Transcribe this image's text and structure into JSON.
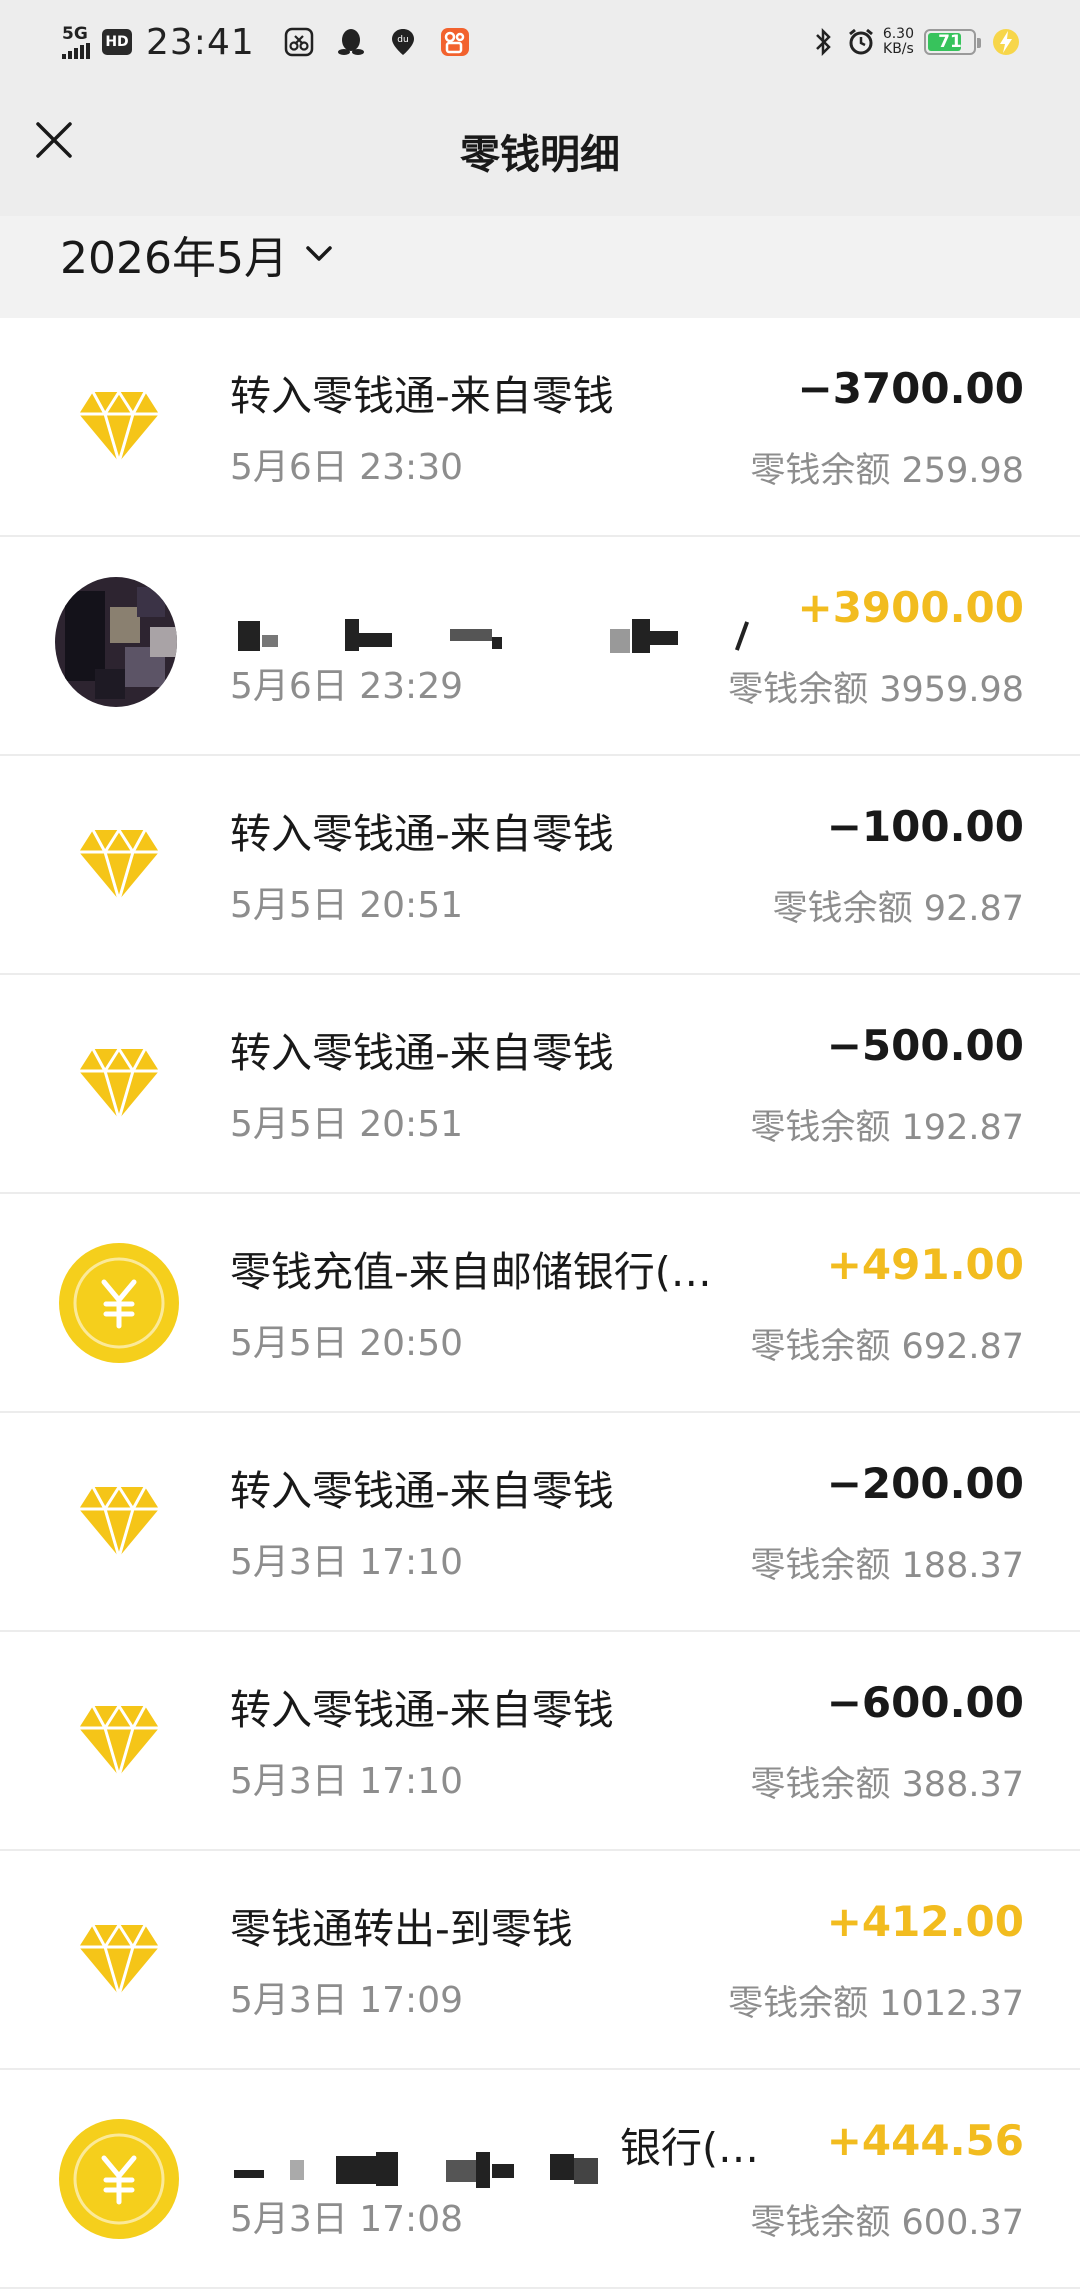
{
  "status_bar": {
    "network": "5G",
    "hd": "HD",
    "time": "23:41",
    "speed_value": "6.30",
    "speed_unit": "KB/s",
    "battery": "71"
  },
  "header": {
    "title": "零钱明细"
  },
  "filter": {
    "month": "2026年5月"
  },
  "transactions": [
    {
      "title": "转入零钱通-来自零钱",
      "date": "5月6日 23:30",
      "amount": "−3700.00",
      "balance": "零钱余额 259.98",
      "icon": "diamond-icon"
    },
    {
      "title": "",
      "date": "5月6日 23:29",
      "amount": "+3900.00",
      "balance": "零钱余额 3959.98",
      "icon": "avatar"
    },
    {
      "title": "转入零钱通-来自零钱",
      "date": "5月5日 20:51",
      "amount": "−100.00",
      "balance": "零钱余额 92.87",
      "icon": "diamond-icon"
    },
    {
      "title": "转入零钱通-来自零钱",
      "date": "5月5日 20:51",
      "amount": "−500.00",
      "balance": "零钱余额 192.87",
      "icon": "diamond-icon"
    },
    {
      "title": "零钱充值-来自邮储银行(…",
      "date": "5月5日 20:50",
      "amount": "+491.00",
      "balance": "零钱余额 692.87",
      "icon": "yuan-coin-icon"
    },
    {
      "title": "转入零钱通-来自零钱",
      "date": "5月3日 17:10",
      "amount": "−200.00",
      "balance": "零钱余额 188.37",
      "icon": "diamond-icon"
    },
    {
      "title": "转入零钱通-来自零钱",
      "date": "5月3日 17:10",
      "amount": "−600.00",
      "balance": "零钱余额 388.37",
      "icon": "diamond-icon"
    },
    {
      "title": "零钱通转出-到零钱",
      "date": "5月3日 17:09",
      "amount": "+412.00",
      "balance": "零钱余额 1012.37",
      "icon": "diamond-icon"
    },
    {
      "title": "银行(…",
      "date": "5月3日 17:08",
      "amount": "+444.56",
      "balance": "零钱余额 600.37",
      "icon": "yuan-coin-icon"
    }
  ],
  "colors": {
    "income": "#f2bc1f",
    "expense": "#191919",
    "header_bg": "#ededed"
  }
}
